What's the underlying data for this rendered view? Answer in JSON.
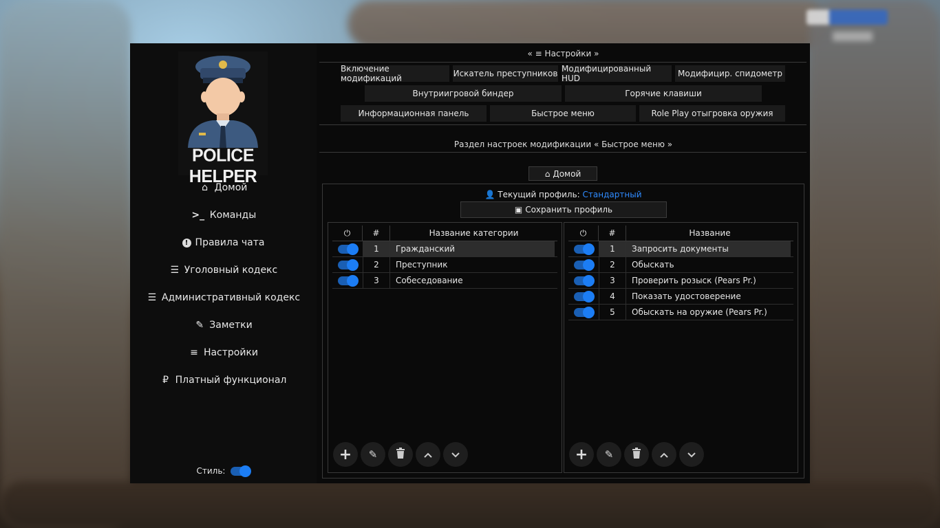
{
  "sidebar": {
    "logo_text": "POLICE HELPER",
    "items": [
      {
        "icon": "home-icon",
        "glyph": "⌂",
        "label": "Домой"
      },
      {
        "icon": "terminal-icon",
        "glyph": ">_",
        "label": "Команды"
      },
      {
        "icon": "exclamation-icon",
        "glyph": "!",
        "label": "Правила чата"
      },
      {
        "icon": "list-icon",
        "glyph": "☰",
        "label": "Уголовный кодекс"
      },
      {
        "icon": "list-icon",
        "glyph": "☰",
        "label": "Административный кодекс"
      },
      {
        "icon": "edit-icon",
        "glyph": "✎",
        "label": "Заметки"
      },
      {
        "icon": "sliders-icon",
        "glyph": "≡",
        "label": "Настройки"
      },
      {
        "icon": "ruble-icon",
        "glyph": "₽",
        "label": "Платный функционал"
      }
    ],
    "style_label": "Стиль:",
    "style_on": true
  },
  "header": {
    "breadcrumb_left": "«",
    "breadcrumb_label": "Настройки",
    "breadcrumb_right": "»"
  },
  "tabs": {
    "row1": [
      "Включение модификаций",
      "Искатель преступников",
      "Модифицированный HUD",
      "Модифицир. спидометр"
    ],
    "row2": [
      "Внутриигровой биндер",
      "Горячие клавиши"
    ],
    "row3": [
      "Информационная панель",
      "Быстрое меню",
      "Role Play отыгровка оружия"
    ]
  },
  "section_title": "Раздел настроек модификации « Быстрое меню »",
  "home_button": "Домой",
  "profile": {
    "label": "Текущий профиль:",
    "name": "Стандартный",
    "save_label": "Сохранить профиль"
  },
  "categories": {
    "headers": [
      "⏻",
      "#",
      "Название категории"
    ],
    "rows": [
      {
        "num": "1",
        "name": "Гражданский",
        "on": true,
        "selected": true
      },
      {
        "num": "2",
        "name": "Преступник",
        "on": true,
        "selected": false
      },
      {
        "num": "3",
        "name": "Собеседование",
        "on": true,
        "selected": false
      }
    ]
  },
  "items": {
    "headers": [
      "⏻",
      "#",
      "Название"
    ],
    "rows": [
      {
        "num": "1",
        "name": "Запросить документы",
        "on": true,
        "selected": true
      },
      {
        "num": "2",
        "name": "Обыскать",
        "on": true,
        "selected": false
      },
      {
        "num": "3",
        "name": "Проверить розыск (Pears Pr.)",
        "on": true,
        "selected": false
      },
      {
        "num": "4",
        "name": "Показать удостоверение",
        "on": true,
        "selected": false
      },
      {
        "num": "5",
        "name": "Обыскать на оружие (Pears Pr.)",
        "on": true,
        "selected": false
      }
    ]
  },
  "action_buttons": [
    {
      "icon": "plus-icon",
      "glyph": "+"
    },
    {
      "icon": "edit-icon",
      "glyph": "✎"
    },
    {
      "icon": "trash-icon",
      "glyph": "🗑"
    },
    {
      "icon": "chevron-up-icon",
      "glyph": "˄"
    },
    {
      "icon": "chevron-down-icon",
      "glyph": "˅"
    }
  ],
  "colors": {
    "accent": "#2f8bff",
    "toggle_on": "#1c7df4",
    "window_bg": "#0a0a0a"
  }
}
